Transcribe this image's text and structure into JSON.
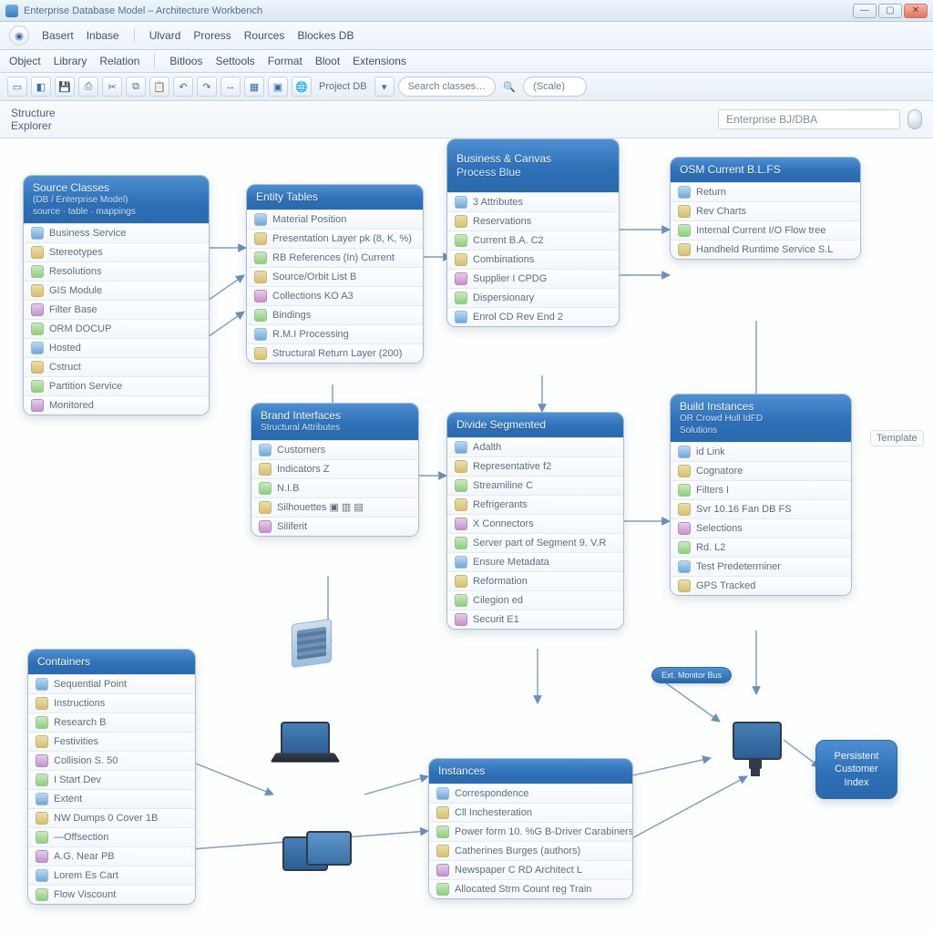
{
  "window": {
    "title": "Enterprise Database Model – Architecture Workbench"
  },
  "win_controls": {
    "min": "—",
    "max": "▢",
    "close": "✕"
  },
  "menu1": {
    "m0": "Basert",
    "m1": "Inbase",
    "m2": "Ulvard",
    "m3": "Proress",
    "m4": "Rources",
    "m5": "Blockes DB"
  },
  "menu2": {
    "m0": "Object",
    "m1": "Library",
    "m2": "Relation",
    "m3": "Bitloos",
    "m4": "Settools",
    "m5": "Format",
    "m6": "Bloot",
    "m7": "Extensions"
  },
  "toolbar": {
    "label_project": "Project DB",
    "search_placeholder": "Search classes…",
    "scale_placeholder": "(Scale)"
  },
  "searchstrip": {
    "label": "Structure Explorer",
    "field": "Enterprise   BJ/DBA"
  },
  "side_label": "Template",
  "pill": {
    "label": "Ext. Monitor Bus"
  },
  "nodes": {
    "storage": {
      "l1": "Persistent",
      "l2": "Customer",
      "l3": "Index"
    }
  },
  "panels": {
    "p1": {
      "title": "Source Classes",
      "sub1": "(DB / Enterprise Model)",
      "sub2": "source · table · mappings",
      "items": [
        "Business Service",
        "Stereotypes",
        "Resolutions",
        "GIS Module",
        "Filter  Base",
        "ORM   DOCUP",
        "Hosted",
        "Cstruct",
        "Partition Service",
        "Monitored"
      ]
    },
    "p2": {
      "title": "Entity  Tables",
      "items": [
        "Material Position",
        "Presentation  Layer  pk (8,  K, %)",
        "RB  References (In)  Current",
        "Source/Orbit  List B",
        "Collections   KO  A3",
        "Bindings",
        "R.M.I  Processing",
        "Structural Return  Layer (200)"
      ]
    },
    "p3": {
      "title": "Business & Canvas",
      "sub": "Process Blue",
      "items": [
        "3 Attributes",
        "Reservations",
        "Current  B.A.  C2",
        "Combinations",
        "Supplier  I  CPDG",
        "Dispersionary",
        "Enrol CD  Rev  End 2"
      ]
    },
    "p4": {
      "title": "OSM  Current  B.L.FS",
      "items": [
        "Return",
        "Rev  Charts",
        "Internal  Current  I/O Flow tree",
        "Handheld  Runtime Service  S.L"
      ]
    },
    "p5": {
      "title": "Brand Interfaces",
      "sub": "Structural Attributes",
      "items": [
        "Customers",
        "Indicators   Z",
        "N.I.B",
        "Silhouettes   ▣ ▥ ▤",
        "Siliferit"
      ]
    },
    "p6": {
      "title": "Divide  Segmented",
      "items": [
        "Adalth",
        "Representative f2",
        "Streamiline C",
        "Refrigerants",
        "X Connectors",
        "Server part of  Segment  9.  V.R",
        "Ensure  Metadata",
        "Reformation",
        "Cilegion ed",
        "Securit   E1"
      ]
    },
    "p7": {
      "title": "Build Instances",
      "sub1": "OR  Crowd Hull  IdFD",
      "sub2": "Solutions",
      "items": [
        "id Link",
        "Cognatore",
        "Filters I",
        "Svr  10.16   Fan  DB FS",
        "Selections",
        "Rd. L2",
        "Test   Predeterminer",
        "GPS Tracked"
      ]
    },
    "p8": {
      "title": "Containers",
      "items": [
        "Sequential  Point",
        "Instructions",
        "Research B",
        "Festivities",
        "Collision  S. 50",
        "I  Start Dev",
        "Extent",
        "NW Dumps  0 Cover  1B",
        "—Offsection",
        "A.G.  Near  PB",
        "Lorem  Es Cart",
        "Flow  Viscount"
      ]
    },
    "p9": {
      "title": "Instances",
      "items": [
        "Correspondence",
        "Cll   Inchesteration",
        "Power form  10.  %G   B-Driver  Carabiners",
        "Catherines   Burges   (authors)",
        "Newspaper   C RD Architect  L",
        "Allocated Strm   Count reg Train"
      ]
    }
  }
}
